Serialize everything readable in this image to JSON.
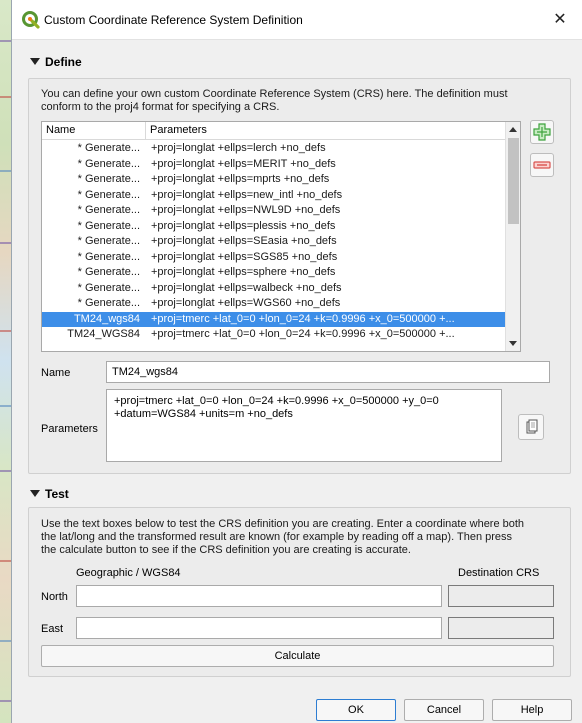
{
  "window": {
    "title": "Custom Coordinate Reference System Definition",
    "close_glyph": "✕",
    "app_icon": "qgis-logo-icon"
  },
  "define": {
    "header": "Define",
    "description_line1": "You can define your own custom Coordinate Reference System (CRS) here. The definition must",
    "description_line2": "conform to the proj4 format for specifying a CRS.",
    "table": {
      "columns": [
        "Name",
        "Parameters"
      ],
      "rows": [
        {
          "name": "* Generate...",
          "params": "+proj=longlat +ellps=lerch +no_defs"
        },
        {
          "name": "* Generate...",
          "params": "+proj=longlat +ellps=MERIT +no_defs"
        },
        {
          "name": "* Generate...",
          "params": "+proj=longlat +ellps=mprts +no_defs"
        },
        {
          "name": "* Generate...",
          "params": "+proj=longlat +ellps=new_intl +no_defs"
        },
        {
          "name": "* Generate...",
          "params": "+proj=longlat +ellps=NWL9D +no_defs"
        },
        {
          "name": "* Generate...",
          "params": "+proj=longlat +ellps=plessis +no_defs"
        },
        {
          "name": "* Generate...",
          "params": "+proj=longlat +ellps=SEasia +no_defs"
        },
        {
          "name": "* Generate...",
          "params": "+proj=longlat +ellps=SGS85 +no_defs"
        },
        {
          "name": "* Generate...",
          "params": "+proj=longlat +ellps=sphere +no_defs"
        },
        {
          "name": "* Generate...",
          "params": "+proj=longlat +ellps=walbeck +no_defs"
        },
        {
          "name": "* Generate...",
          "params": "+proj=longlat +ellps=WGS60 +no_defs"
        },
        {
          "name": "TM24_wgs84",
          "params": "+proj=tmerc +lat_0=0 +lon_0=24 +k=0.9996 +x_0=500000 +...",
          "selected": true
        },
        {
          "name": "TM24_WGS84",
          "params": "+proj=tmerc +lat_0=0 +lon_0=24 +k=0.9996 +x_0=500000 +..."
        }
      ]
    },
    "add_icon": "plus-icon",
    "remove_icon": "minus-icon",
    "name_label": "Name",
    "name_value": "TM24_wgs84",
    "parameters_label": "Parameters",
    "parameters_value": "+proj=tmerc +lat_0=0 +lon_0=24 +k=0.9996 +x_0=500000 +y_0=0\n+datum=WGS84 +units=m +no_defs",
    "copy_icon": "copy-icon"
  },
  "test": {
    "header": "Test",
    "description_line1": "Use the text boxes below to test the CRS definition you are creating. Enter a coordinate where both",
    "description_line2": "the lat/long and the transformed result are known (for example by reading off a map). Then press",
    "description_line3": "the calculate button to see if the CRS definition you are creating is accurate.",
    "geographic_label": "Geographic / WGS84",
    "destination_label": "Destination CRS",
    "north_label": "North",
    "east_label": "East",
    "north_value": "",
    "east_value": "",
    "calculate_label": "Calculate"
  },
  "footer": {
    "ok_label": "OK",
    "cancel_label": "Cancel",
    "help_label": "Help"
  },
  "colors": {
    "selection": "#3d8ee8",
    "add_green": "#3ea33e",
    "remove_red": "#d9534f",
    "default_button_border": "#2d7dd2"
  }
}
